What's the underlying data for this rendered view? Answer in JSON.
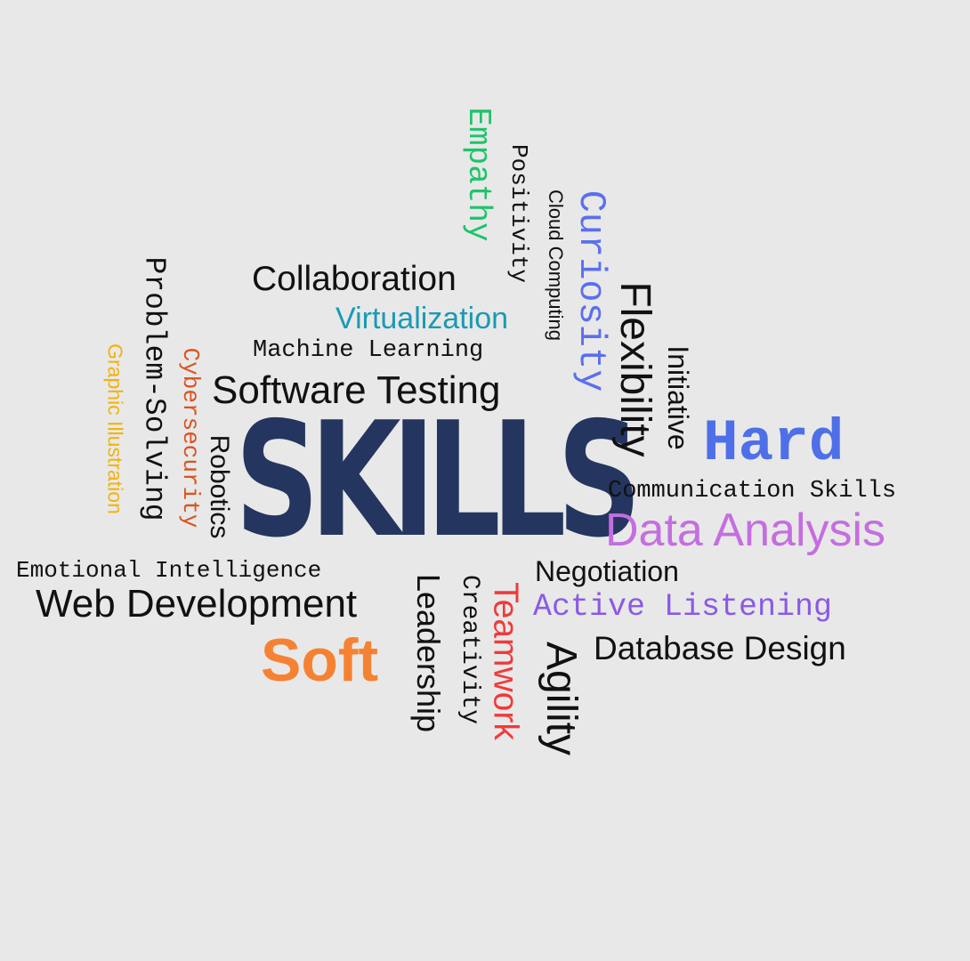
{
  "words": {
    "skills": "SKILLS",
    "hard": "Hard",
    "soft": "Soft",
    "collaboration": "Collaboration",
    "virtualization": "Virtualization",
    "machine_learning": "Machine Learning",
    "software_testing": "Software Testing",
    "communication_skills": "Communication Skills",
    "data_analysis": "Data Analysis",
    "emotional_intelligence": "Emotional Intelligence",
    "web_development": "Web Development",
    "negotiation": "Negotiation",
    "active_listening": "Active Listening",
    "database_design": "Database Design",
    "empathy": "Empathy",
    "positivity": "Positivity",
    "cloud_computing": "Cloud Computing",
    "curiosity": "Curiosity",
    "flexibility": "Flexibility",
    "initiative": "Initiative",
    "problem_solving": "Problem-Solving",
    "graphic_illustration": "Graphic Illustration",
    "cybersecurity": "Cybersecurity",
    "robotics": "Robotics",
    "leadership": "Leadership",
    "creativity": "Creativity",
    "teamwork": "Teamwork",
    "agility": "Agility"
  },
  "colors": {
    "background": "#e8e8e8",
    "skills": "#24365f",
    "hard": "#4f6fe8",
    "soft": "#f58233",
    "virtualization": "#1a9ab4",
    "data_analysis": "#c46ee0",
    "active_listening": "#8a5ae6",
    "empathy": "#1ec46a",
    "curiosity": "#5a6ff0",
    "graphic_illustration": "#f2b30a",
    "cybersecurity": "#d9531f",
    "teamwork": "#f03a3a",
    "default": "#111111"
  }
}
